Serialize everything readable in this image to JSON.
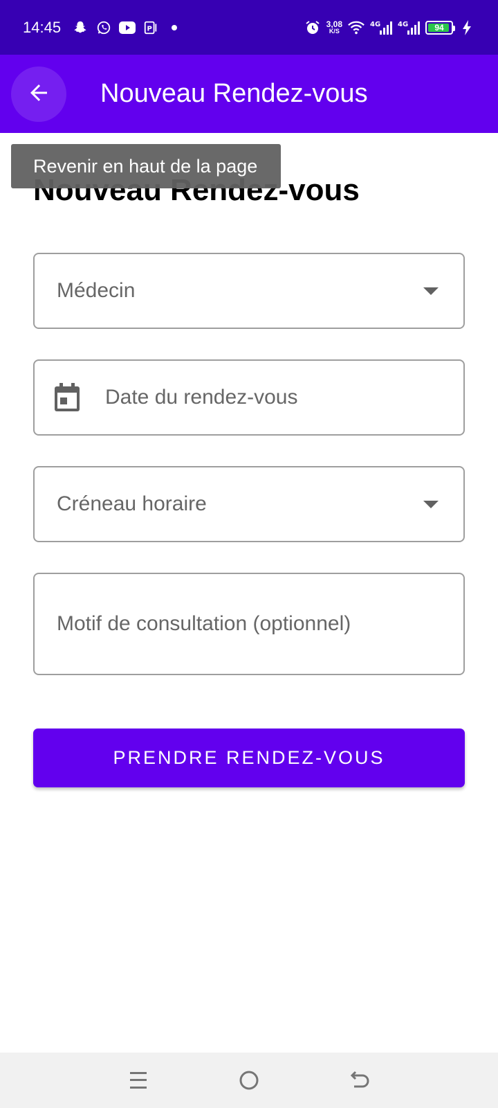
{
  "status_bar": {
    "time": "14:45",
    "net_speed_value": "3,08",
    "net_speed_unit": "K/S",
    "battery_percent": "94",
    "battery_level": 0.94,
    "icons": [
      "snapchat-icon",
      "whatsapp-icon",
      "youtube-icon",
      "parking-app-icon",
      "dot-icon",
      "alarm-icon",
      "wifi-icon",
      "signal-4g-icon",
      "signal-4g-icon",
      "battery-icon",
      "charging-icon"
    ],
    "signal_label": "4G"
  },
  "app_bar": {
    "title": "Nouveau Rendez-vous",
    "back_icon": "arrow-left-icon"
  },
  "tooltip": {
    "text": "Revenir en haut de la page"
  },
  "page": {
    "heading": "Nouveau Rendez-vous"
  },
  "form": {
    "doctor_placeholder": "Médecin",
    "date_placeholder": "Date du rendez-vous",
    "slot_placeholder": "Créneau horaire",
    "reason_placeholder": "Motif de consultation (optionnel)",
    "submit_label": "PRENDRE RENDEZ-VOUS"
  },
  "colors": {
    "status_bar": "#3700b3",
    "primary": "#6200ee",
    "battery_fill": "#2bc64a"
  },
  "nav_bar": {
    "icons": [
      "recent-apps-icon",
      "home-icon",
      "back-icon"
    ]
  }
}
